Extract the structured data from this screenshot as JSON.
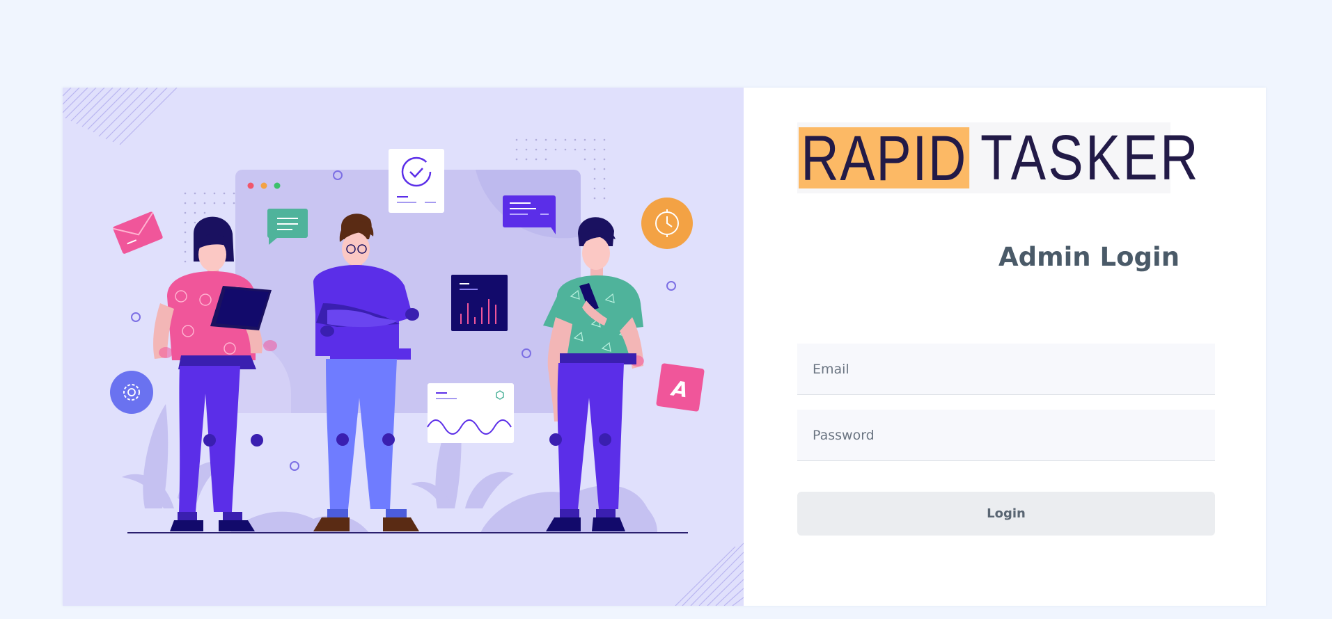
{
  "brand": {
    "logo_part1": "RAPID",
    "logo_part2": "TASKER",
    "logo_highlight_color": "#fcb965",
    "logo_text_color": "#221a47"
  },
  "login": {
    "title": "Admin Login",
    "email_placeholder": "Email",
    "password_placeholder": "Password",
    "submit_label": "Login"
  },
  "illustration": {
    "tile_letter": "A"
  },
  "colors": {
    "page_background": "#f0f5fe",
    "illustration_background": "#e0e0fc",
    "accent_purple": "#5b2ee8",
    "accent_pink": "#f0569a",
    "accent_orange": "#f3a244",
    "accent_teal": "#4fb39b"
  }
}
